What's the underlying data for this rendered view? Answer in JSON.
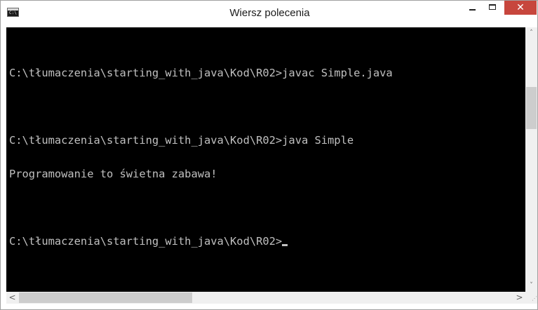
{
  "window": {
    "title": "Wiersz polecenia",
    "app_icon_text": "C:\\",
    "close_glyph": "✕",
    "accent_close": "#c7463d"
  },
  "console": {
    "background": "#000000",
    "foreground": "#c0c0c0",
    "lines": [
      "C:\\tłumaczenia\\starting_with_java\\Kod\\R02>javac Simple.java",
      "",
      "C:\\tłumaczenia\\starting_with_java\\Kod\\R02>java Simple",
      "Programowanie to świetna zabawa!",
      "",
      "C:\\tłumaczenia\\starting_with_java\\Kod\\R02>"
    ]
  },
  "scrollbars": {
    "up_glyph": "˄",
    "down_glyph": "˅",
    "left_glyph": "<",
    "right_glyph": ">",
    "grip_glyph": "⋰"
  }
}
